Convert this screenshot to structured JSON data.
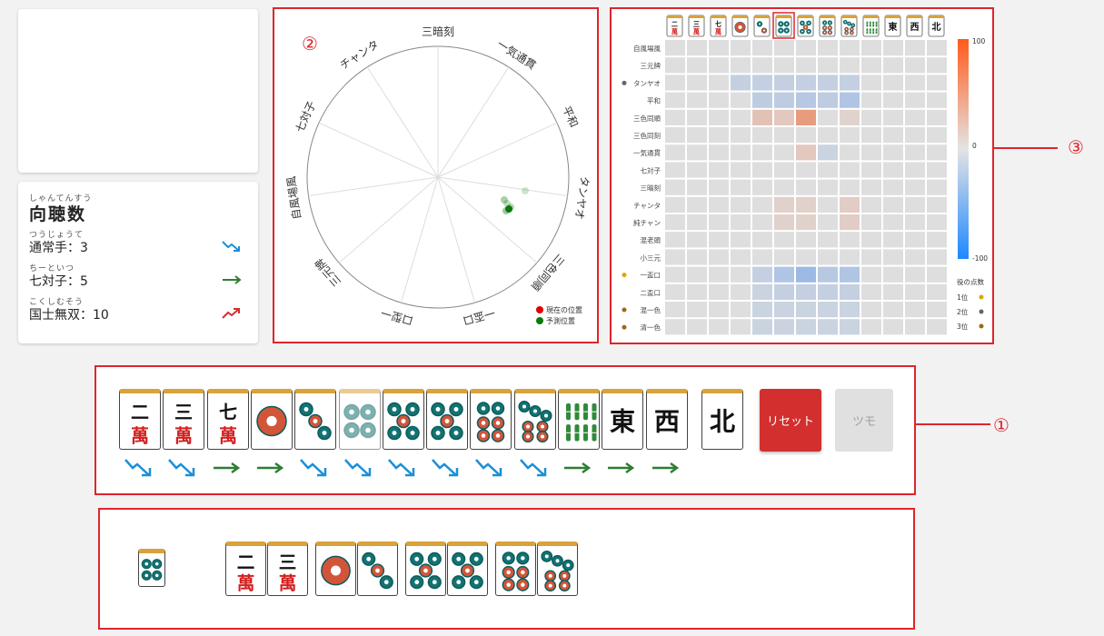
{
  "shanten": {
    "title_ruby": "しゃんてんすう",
    "title": "向聴数",
    "rows": [
      {
        "ruby": "つうじょうて",
        "label": "通常手：3",
        "trend": "down"
      },
      {
        "ruby": "ちーといつ",
        "label": "七対子：5",
        "trend": "flat"
      },
      {
        "ruby": "こくしむそう",
        "label": "国士無双：10",
        "trend": "up"
      }
    ]
  },
  "annotations": [
    "②",
    "③",
    "①"
  ],
  "radar": {
    "axes": [
      "三暗刻",
      "一気通貫",
      "平和",
      "タンヤオ",
      "三色同順",
      "一盃口",
      "口型一",
      "三元牌",
      "自風場風",
      "七対子",
      "チャンタ"
    ],
    "legend": [
      {
        "label": "現在の位置",
        "color": "#e00000"
      },
      {
        "label": "予測位置",
        "color": "#0a7a0a"
      }
    ]
  },
  "heatmap": {
    "header_tiles": [
      "二萬",
      "三萬",
      "七萬",
      "1p",
      "2p",
      "4p",
      "5p",
      "6p",
      "7p",
      "8s",
      "東",
      "西",
      "北"
    ],
    "selected_col": 5,
    "rows": [
      {
        "label": "自風場風",
        "marker": ""
      },
      {
        "label": "三元牌",
        "marker": ""
      },
      {
        "label": "タンヤオ",
        "marker": "#666666"
      },
      {
        "label": "平和",
        "marker": ""
      },
      {
        "label": "三色同順",
        "marker": ""
      },
      {
        "label": "三色同刻",
        "marker": ""
      },
      {
        "label": "一気通貫",
        "marker": ""
      },
      {
        "label": "七対子",
        "marker": ""
      },
      {
        "label": "三暗刻",
        "marker": ""
      },
      {
        "label": "チャンタ",
        "marker": ""
      },
      {
        "label": "純チャン",
        "marker": ""
      },
      {
        "label": "混老頭",
        "marker": ""
      },
      {
        "label": "小三元",
        "marker": ""
      },
      {
        "label": "一盃口",
        "marker": "#d9a800"
      },
      {
        "label": "二盃口",
        "marker": ""
      },
      {
        "label": "混一色",
        "marker": "#9a6a1a"
      },
      {
        "label": "清一色",
        "marker": "#9a6a1a"
      }
    ],
    "scale": {
      "max": "100",
      "mid": "0",
      "min": "-100"
    },
    "rank_title": "役の点数",
    "ranks": [
      {
        "label": "1位",
        "color": "#d9a800"
      },
      {
        "label": "2位",
        "color": "#666666"
      },
      {
        "label": "3位",
        "color": "#9a6a1a"
      }
    ]
  },
  "hand": {
    "tiles": [
      "二萬",
      "三萬",
      "七萬",
      "1p",
      "3p",
      "4p",
      "5p",
      "5p",
      "6p",
      "7p",
      "8s",
      "東",
      "西"
    ],
    "trends": [
      "down",
      "down",
      "flat",
      "flat",
      "down",
      "down",
      "down",
      "down",
      "down",
      "down",
      "flat",
      "flat",
      "flat"
    ],
    "drawn": "北",
    "reset_label": "リセット",
    "tsumo_label": "ツモ"
  },
  "melds": {
    "single": "4p",
    "groups": [
      [
        "二萬",
        "三萬"
      ],
      [
        "1p",
        "3p"
      ],
      [
        "5p",
        "5p"
      ],
      [
        "6p",
        "7p"
      ]
    ]
  }
}
